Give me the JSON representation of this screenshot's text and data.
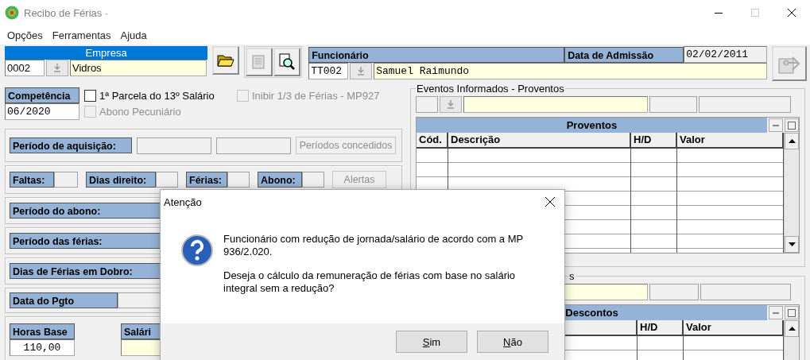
{
  "window": {
    "title": "Recibo de Férias ·"
  },
  "menu": [
    "Opções",
    "Ferramentas",
    "Ajuda"
  ],
  "empresa": {
    "label": "Empresa",
    "code": "0002",
    "name": "Vidros"
  },
  "funcionario": {
    "label": "Funcionário",
    "admission_label": "Data de Admissão",
    "admission_date": "02/02/2011",
    "code": "TT002",
    "name": "Samuel Raimundo"
  },
  "competencia": {
    "label": "Competência",
    "value": "06/2020"
  },
  "options": [
    {
      "label": "1ª Parcela do 13º Salário",
      "checked": false,
      "disabled": false
    },
    {
      "label": "Inibir 1/3 de Férias - MP927",
      "checked": false,
      "disabled": true
    },
    {
      "label": "Abono Pecuniário",
      "checked": false,
      "disabled": true
    }
  ],
  "aquisicao": {
    "label": "Período de aquisição:",
    "button": {
      "label": "Períodos concedidos",
      "disabled": true
    }
  },
  "counts": [
    "Faltas:",
    "Dias direito:",
    "Férias:",
    "Abono:"
  ],
  "alerts_button": {
    "label": "Alertas",
    "disabled": true
  },
  "periods": [
    "Período do abono:",
    "Período das férias:",
    "Dias de Férias em Dobro:"
  ],
  "payment": {
    "label": "Data do Pgto"
  },
  "hours": {
    "label": "Horas Base",
    "value": "110,00"
  },
  "salary": {
    "label": "Salári"
  },
  "proventos": {
    "group": "Eventos Informados - Proventos",
    "title": "Proventos",
    "columns": [
      "Cód.",
      "Descrição",
      "H/D",
      "Valor"
    ]
  },
  "descontos": {
    "group": "s",
    "title": "Descontos",
    "columns": [
      "H/D",
      "Valor"
    ]
  },
  "dialog": {
    "title": "Atenção",
    "paragraphs": [
      "Funcionário com redução de jornada/salário de acordo com a MP 936/2.020.",
      "Deseja o cálculo da remuneração de férias com base no salário integral sem a redução?"
    ],
    "buttons": [
      "Sim",
      "Não"
    ]
  }
}
